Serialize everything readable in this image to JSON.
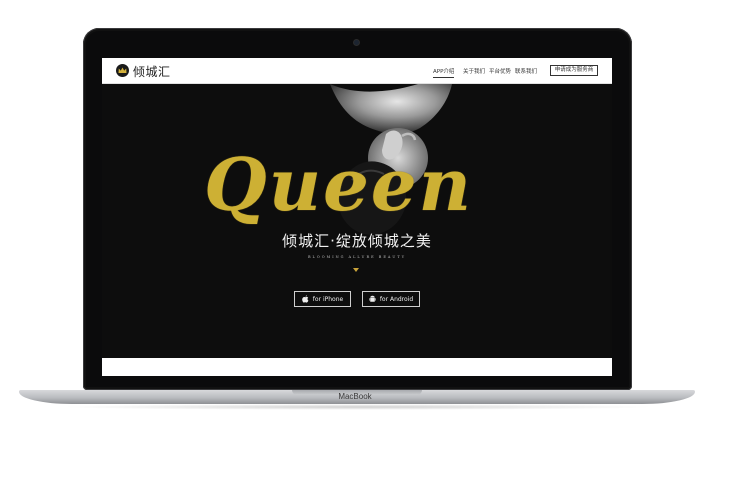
{
  "device": {
    "brand_label": "MacBook"
  },
  "navbar": {
    "logo_text": "倾城汇",
    "logo_icon": "crown-icon",
    "items": [
      {
        "label": "APP介绍",
        "active": true
      },
      {
        "label": "关于我们",
        "active": false
      },
      {
        "label": "平台优势",
        "active": false
      },
      {
        "label": "联系我们",
        "active": false
      }
    ],
    "apply_button": "申请成为服务商"
  },
  "hero": {
    "script_word": "Queen",
    "title": "倾城汇·绽放倾城之美",
    "subtitle": "BLOOMING ALLURE BEAUTY",
    "arrow_icon": "triangle-down-icon",
    "buttons": [
      {
        "label": "for iPhone",
        "icon": "apple-icon"
      },
      {
        "label": "for Android",
        "icon": "android-icon"
      }
    ]
  },
  "colors": {
    "accent_gold": "#cdb034",
    "hero_background": "#0d0d0d",
    "navbar_background": "#ffffff"
  }
}
